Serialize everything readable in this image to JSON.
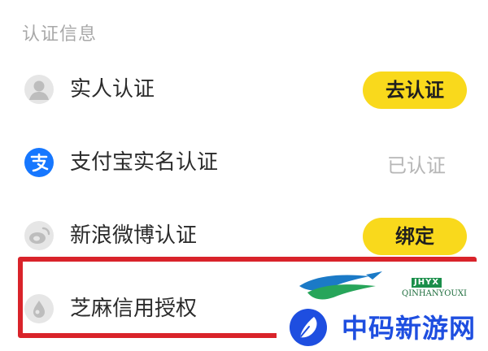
{
  "section": {
    "title": "认证信息"
  },
  "rows": [
    {
      "label": "实人认证",
      "action": "去认证",
      "icon": "user-avatar-icon"
    },
    {
      "label": "支付宝实名认证",
      "status": "已认证",
      "icon": "alipay-icon"
    },
    {
      "label": "新浪微博认证",
      "action": "绑定",
      "icon": "weibo-icon"
    },
    {
      "label": "芝麻信用授权",
      "icon": "sesame-credit-icon"
    }
  ],
  "watermark": {
    "name": "中码新游网",
    "badge": "JHYX",
    "sub": "QINHANYOUXI"
  },
  "colors": {
    "accent_yellow": "#f9d91c",
    "highlight_red": "#d9232a",
    "muted_text": "#b6b6b6",
    "watermark_blue": "#1e4ee0"
  }
}
